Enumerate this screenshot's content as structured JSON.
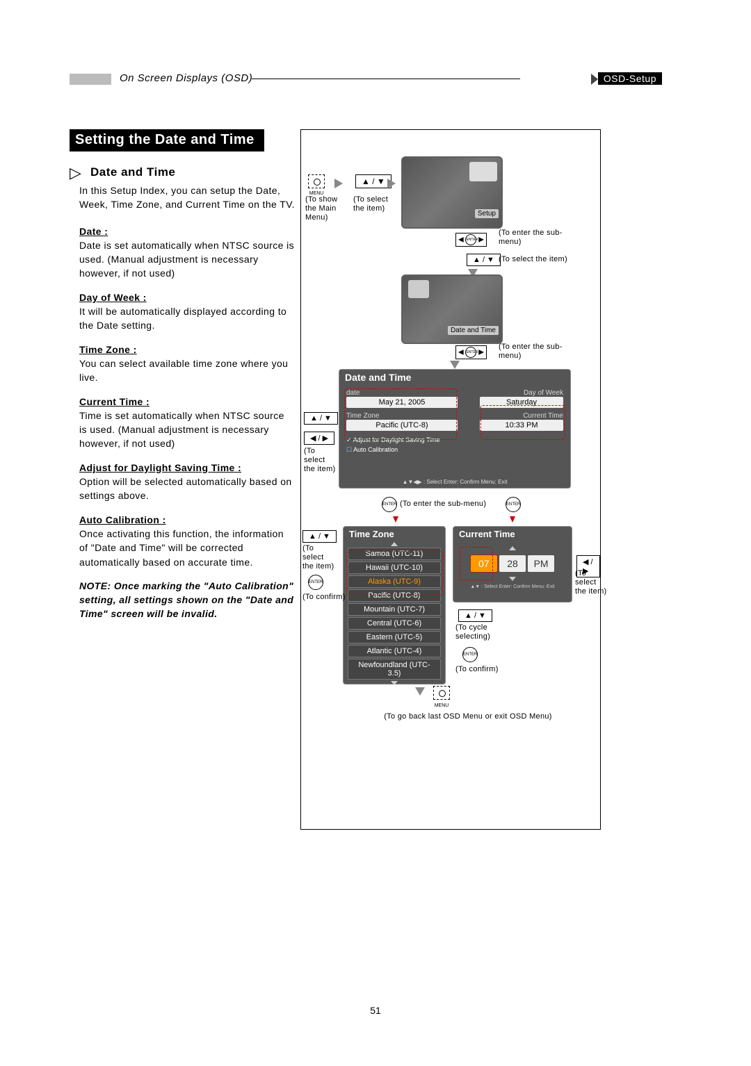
{
  "header": {
    "left": "On Screen Displays (OSD)",
    "right": "OSD-Setup"
  },
  "section_title": "Setting the Date and Time",
  "subsection_title": "Date and Time",
  "intro": "In this Setup Index, you can setup the Date, Week, Time Zone, and Current Time on the TV.",
  "items": [
    {
      "label": "Date :",
      "desc": "Date is set automatically when NTSC source is used. (Manual adjustment is necessary however, if not used)"
    },
    {
      "label": "Day of Week :",
      "desc": "It will be automatically displayed according to the Date setting."
    },
    {
      "label": "Time Zone :",
      "desc": "You can select available time zone where you live."
    },
    {
      "label": "Current Time :",
      "desc": "Time is set automatically when NTSC source is used. (Manual adjustment is necessary however, if not used)"
    },
    {
      "label": "Adjust for Daylight Saving Time :",
      "desc": "Option will be selected automatically based on settings above."
    },
    {
      "label": "Auto Calibration :",
      "desc": "Once activating this function, the information of \"Date and Time\" will be corrected automatically based on accurate time."
    }
  ],
  "note": "NOTE: Once marking the \"Auto Calibration\" setting, all settings shown on the \"Date and Time\" screen will be invalid.",
  "keys": {
    "menu": "MENU",
    "updown": "▲ / ▼",
    "leftright": "◀ / ▶",
    "enter": "ENTER"
  },
  "captions": {
    "show_main": "(To show the Main Menu)",
    "select_item": "(To select the item)",
    "enter_sub": "(To enter the sub-menu)",
    "select_item2": "(To select the item)",
    "to_confirm": "(To confirm)",
    "to_cycle": "(To cycle selecting)",
    "go_back": "(To go back last OSD Menu or exit OSD Menu)"
  },
  "tv": {
    "setup_tag": "Setup",
    "dt_tag": "Date and Time"
  },
  "osd": {
    "title": "Date and Time",
    "date_label": "date",
    "date_val": "May 21, 2005",
    "dow_label": "Day of Week",
    "dow_val": "Saturday",
    "tz_label": "Time Zone",
    "tz_val": "Pacific (UTC-8)",
    "ct_label": "Current Time",
    "ct_val": "10:33 PM",
    "dst": "Adjust for Daylight Saving Time",
    "auto": "Auto Calibration",
    "hint": "▲▼◀▶ : Select    Enter: Confirm    Menu: Exit"
  },
  "tz_panel": {
    "title": "Time Zone",
    "items": [
      "Samoa (UTC-11)",
      "Hawaii (UTC-10)",
      "Alaska (UTC-9)",
      "Pacific (UTC-8)",
      "Mountain (UTC-7)",
      "Central (UTC-6)",
      "Eastern (UTC-5)",
      "Atlantic (UTC-4)",
      "Newfoundland (UTC-3.5)"
    ]
  },
  "ct_panel": {
    "title": "Current Time",
    "h": "07",
    "m": "28",
    "ampm": "PM",
    "hint": "▲▼ : Select   Enter: Confirm   Menu: Exit"
  },
  "page_number": "51"
}
